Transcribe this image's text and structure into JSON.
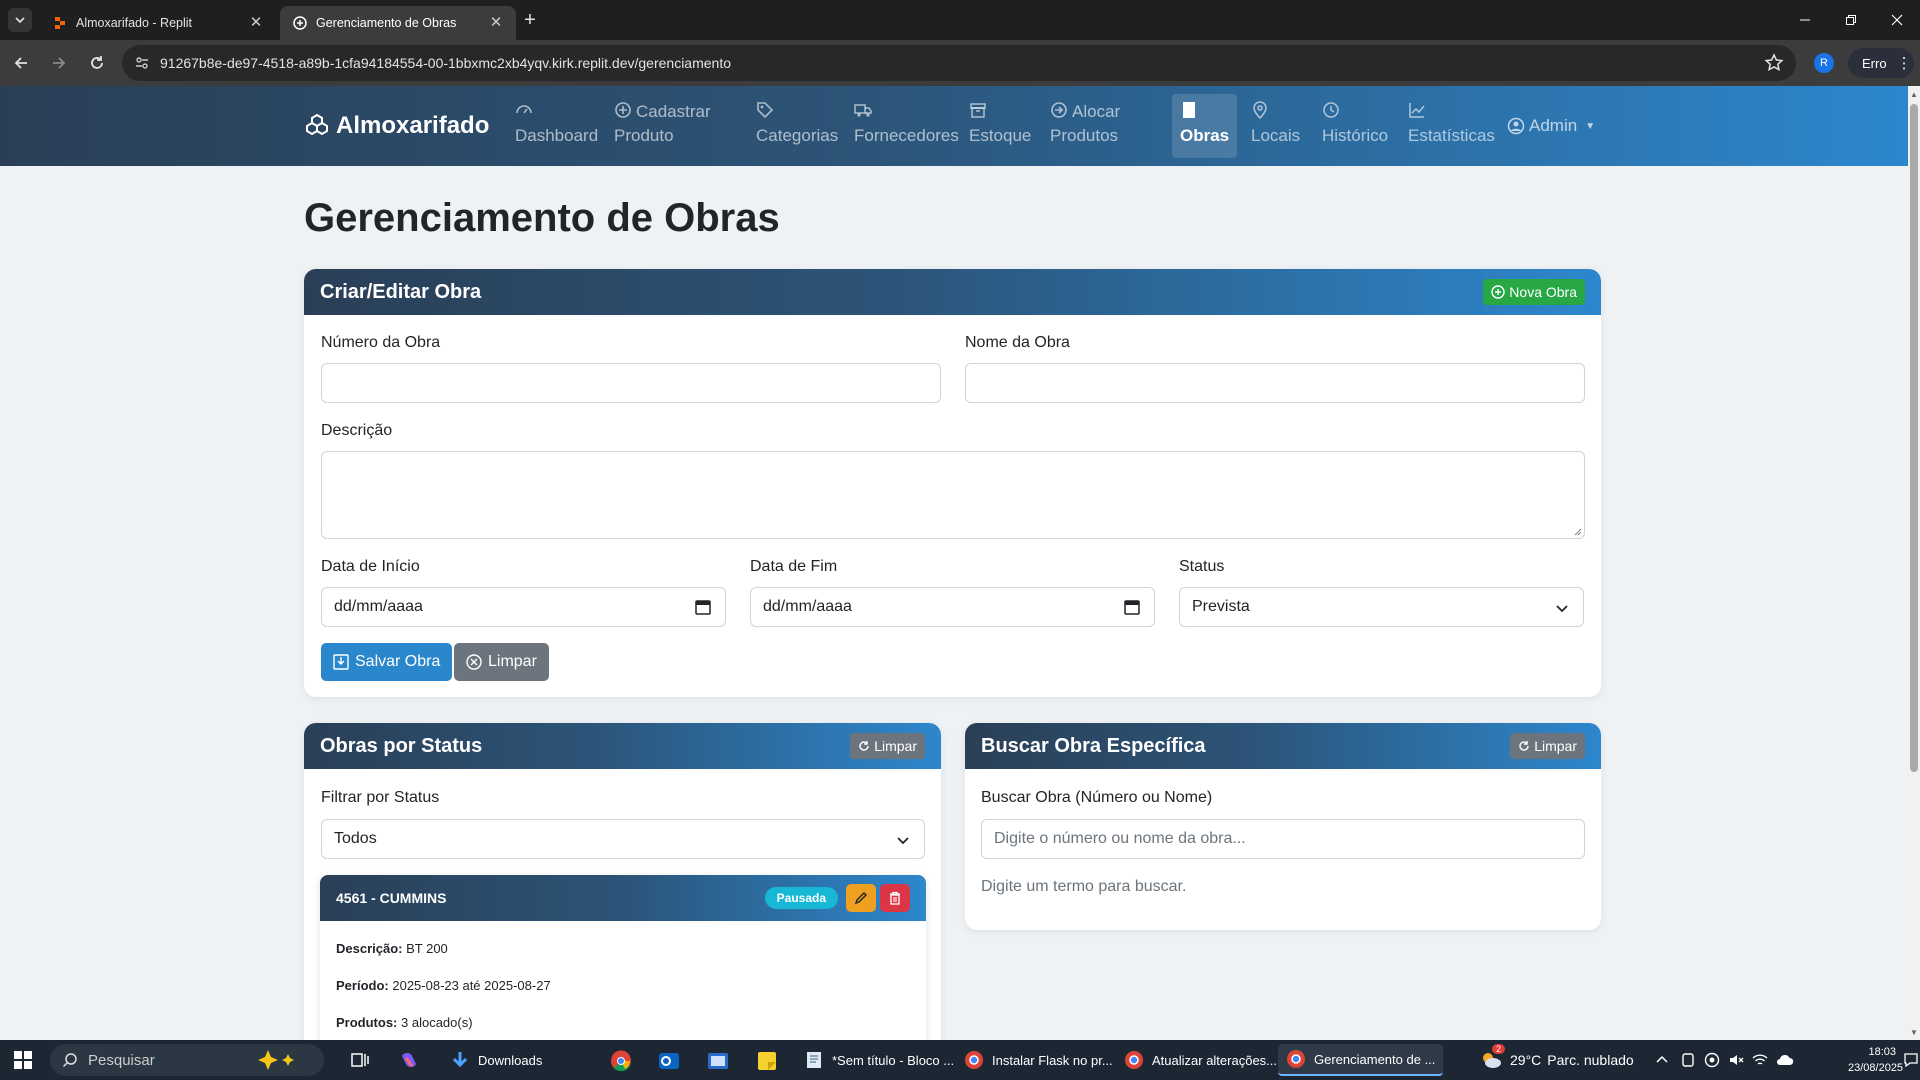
{
  "browser": {
    "tabs": [
      {
        "title": "Almoxarifado - Replit",
        "active": false
      },
      {
        "title": "Gerenciamento de Obras",
        "active": true
      }
    ],
    "url": "91267b8e-de97-4518-a89b-1cfa94184554-00-1bbxmc2xb4yqv.kirk.replit.dev/gerenciamento",
    "profile_initial": "R",
    "error_label": "Erro"
  },
  "navbar": {
    "brand": "Almoxarifado",
    "items": [
      {
        "line1": "Dashboard",
        "line2": "",
        "icon": "gauge-icon"
      },
      {
        "line1": "Cadastrar",
        "line2": "Produto",
        "icon": "plus-circle-icon"
      },
      {
        "line1": "Categorias",
        "line2": "",
        "icon": "tag-icon"
      },
      {
        "line1": "Fornecedores",
        "line2": "",
        "icon": "truck-icon"
      },
      {
        "line1": "Estoque",
        "line2": "",
        "icon": "archive-icon"
      },
      {
        "line1": "Alocar",
        "line2": "Produtos",
        "icon": "arrow-circle-icon"
      },
      {
        "line1": "Obras",
        "line2": "",
        "icon": "building-icon",
        "active": true
      },
      {
        "line1": "Locais",
        "line2": "",
        "icon": "pin-icon"
      },
      {
        "line1": "Histórico",
        "line2": "",
        "icon": "clock-icon"
      },
      {
        "line1": "Estatísticas",
        "line2": "",
        "icon": "chart-icon"
      }
    ],
    "user": "Admin"
  },
  "page": {
    "title": "Gerenciamento de Obras"
  },
  "form": {
    "header": "Criar/Editar Obra",
    "new_button": "Nova Obra",
    "numero_label": "Número da Obra",
    "numero_value": "",
    "nome_label": "Nome da Obra",
    "nome_value": "",
    "descricao_label": "Descrição",
    "descricao_value": "",
    "inicio_label": "Data de Início",
    "inicio_placeholder": "dd/mm/aaaa",
    "fim_label": "Data de Fim",
    "fim_placeholder": "dd/mm/aaaa",
    "status_label": "Status",
    "status_value": "Prevista",
    "save_button": "Salvar Obra",
    "clear_button": "Limpar"
  },
  "status_panel": {
    "header": "Obras por Status",
    "clear_button": "Limpar",
    "filter_label": "Filtrar por Status",
    "filter_value": "Todos",
    "obra": {
      "title": "4561 - CUMMINS",
      "status": "Pausada",
      "descricao_label": "Descrição:",
      "descricao": "BT 200",
      "periodo_label": "Período:",
      "periodo": "2025-08-23 até 2025-08-27",
      "produtos_label": "Produtos:",
      "produtos": "3 alocado(s)"
    }
  },
  "search_panel": {
    "header": "Buscar Obra Específica",
    "clear_button": "Limpar",
    "label": "Buscar Obra (Número ou Nome)",
    "placeholder": "Digite o número ou nome da obra...",
    "hint": "Digite um termo para buscar."
  },
  "taskbar": {
    "search_placeholder": "Pesquisar",
    "items": [
      {
        "label": "Downloads"
      },
      {
        "label": "*Sem título - Bloco ..."
      },
      {
        "label": "Instalar Flask no pr..."
      },
      {
        "label": "Atualizar alterações..."
      },
      {
        "label": "Gerenciamento de ..."
      }
    ],
    "weather_temp": "29°C",
    "weather_desc": "Parc. nublado",
    "time": "18:03",
    "date": "23/08/2025",
    "notification_count": "2"
  },
  "colors": {
    "navbar_start": "#2a3f56",
    "navbar_end": "#2d87cd",
    "primary": "#2b87cc",
    "success": "#28a745",
    "info_pill": "#17b7d6",
    "warning": "#f0a020",
    "danger": "#dc3545",
    "secondary": "#6c757d"
  }
}
